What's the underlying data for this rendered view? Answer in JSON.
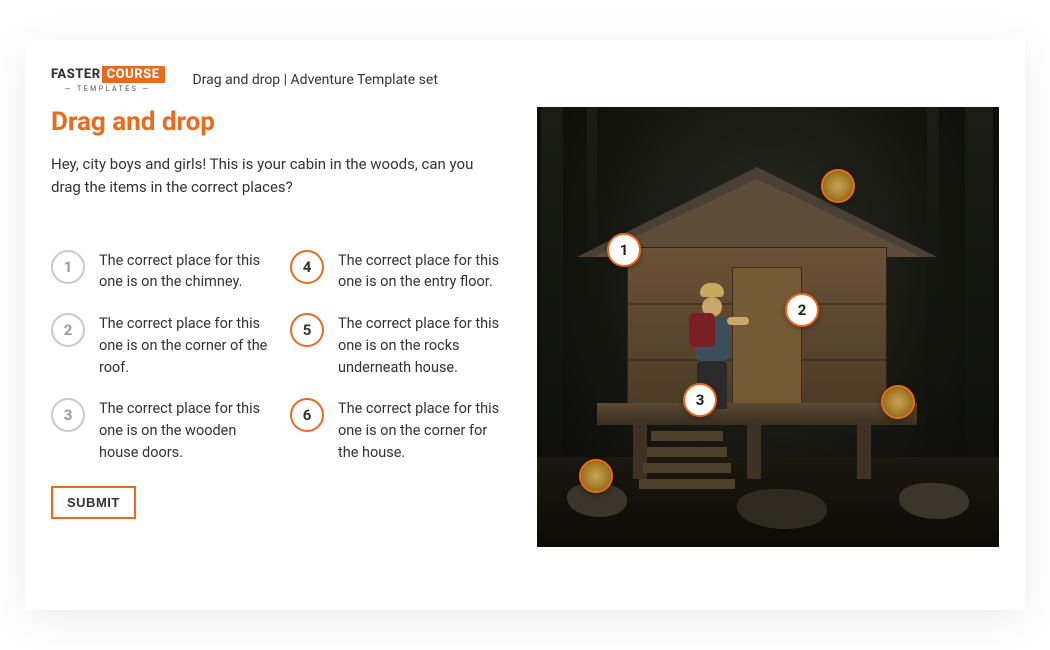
{
  "logo": {
    "faster": "FASTER",
    "course": "COURSE",
    "sub": "— TEMPLATES —"
  },
  "breadcrumb": "Drag and drop | Adventure Template set",
  "title": "Drag and drop",
  "instructions": "Hey, city boys and girls! This is your cabin in the woods, can you drag the items in the correct places?",
  "hints": {
    "left": [
      {
        "num": "1",
        "text": "The correct place for this one is on the chimney."
      },
      {
        "num": "2",
        "text": "The correct place for this one is on the corner of the roof."
      },
      {
        "num": "3",
        "text": "The correct place for this one is on the wooden house doors."
      }
    ],
    "right": [
      {
        "num": "4",
        "text": "The correct place for this one is on the entry floor."
      },
      {
        "num": "5",
        "text": "The correct place for this one is on the rocks underneath house."
      },
      {
        "num": "6",
        "text": "The correct place for this one is on the corner for the house."
      }
    ]
  },
  "drops": {
    "d1": "1",
    "d2": "2",
    "d3": "3"
  },
  "submit": "SUBMIT"
}
